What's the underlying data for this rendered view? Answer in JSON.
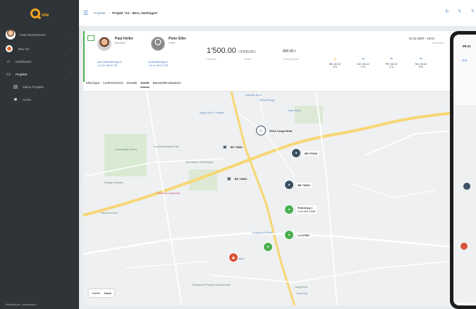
{
  "sidebar": {
    "logo_text": "site",
    "user_name": "Hans Mustermann",
    "items": [
      {
        "label": "Bau AG"
      },
      {
        "label": "Dashboard"
      },
      {
        "label": "Projekte"
      },
      {
        "label": "Meine Projekte"
      },
      {
        "label": "Archiv"
      }
    ],
    "footer": "Rechtliches | Impressum"
  },
  "topbar": {
    "breadcrumb_root": "Projekte",
    "breadcrumb_current": "Projekt \"A2 - Bern, Herkingen\"",
    "separator": "›"
  },
  "header": {
    "contacts": [
      {
        "name": "Paul Heller",
        "role": "Bauleiter",
        "email": "paul.heller@bauag.ch",
        "phone": "+41 41 454 57 38"
      },
      {
        "name": "Peter Eller",
        "role": "Polier",
        "email": "p.eller@bauag.ch",
        "phone": "+41 41 454 37 89"
      }
    ],
    "amount_main": "1'500.00",
    "amount_total": "/ 9'500.00 t",
    "label_geliefert": "Geliefert",
    "label_bedarf": "Bedarf",
    "amount_heute": "800.00 t",
    "label_heute": "Heute geliefert",
    "date": "02.12.2020 – 15:01",
    "date_sub": "Aktualisiert",
    "weather": [
      {
        "day": "MI, 02.12",
        "temp": "1°C",
        "icon": "sun-icon"
      },
      {
        "day": "DO, 03.12",
        "temp": "1°C",
        "icon": "rain-icon"
      },
      {
        "day": "FR, 04.12",
        "temp": "-1°C",
        "icon": "rain-icon"
      },
      {
        "day": "SA, 04.12",
        "temp": "0°C",
        "icon": "rain-icon"
      }
    ]
  },
  "tabs": [
    {
      "label": "Mischgut"
    },
    {
      "label": "Lieferscheine"
    },
    {
      "label": "Details"
    },
    {
      "label": "Karte"
    },
    {
      "label": "Baustellensituation"
    }
  ],
  "map": {
    "markers": [
      {
        "label": "Werk Langenthal"
      },
      {
        "label": "BE 76851"
      },
      {
        "label": "BE 57689"
      },
      {
        "label": "BE 76851"
      },
      {
        "label": "BE 76891"
      },
      {
        "label": "Fahrzeug 1"
      },
      {
        "label": "CLN MS 0959"
      },
      {
        "label": "LU 67567"
      }
    ],
    "pois": [
      {
        "label": "Industrie Nord"
      },
      {
        "label": "Manor Brugg"
      },
      {
        "label": "Migros Do it + Garden"
      },
      {
        "label": "Lanzenwald Quarry"
      },
      {
        "label": "Hotel Stofel"
      },
      {
        "label": "Lenzbachstrasse Park"
      },
      {
        "label": "Gymnasium Oberaargau"
      },
      {
        "label": "Garage Gassann"
      },
      {
        "label": "Parkbad Langenthal"
      },
      {
        "label": "Kantonsschule"
      },
      {
        "label": "Hotel Bären"
      },
      {
        "label": "Restaurant Rössli"
      },
      {
        "label": "Langenthal"
      },
      {
        "label": "Coop City"
      },
      {
        "label": "Restaurant Pizzeria Schwarzwald"
      }
    ],
    "maptype_satellit": "Satellit",
    "maptype_karte": "Karte"
  },
  "phone": {
    "time": "09:41",
    "back": "‹ Zur"
  },
  "colors": {
    "accent": "#3b7cc4",
    "sidebar_bg": "#2f3438",
    "logo": "#f5a623",
    "green": "#4caf50",
    "marker_dark": "#3d5165",
    "marker_red": "#d9533a"
  }
}
